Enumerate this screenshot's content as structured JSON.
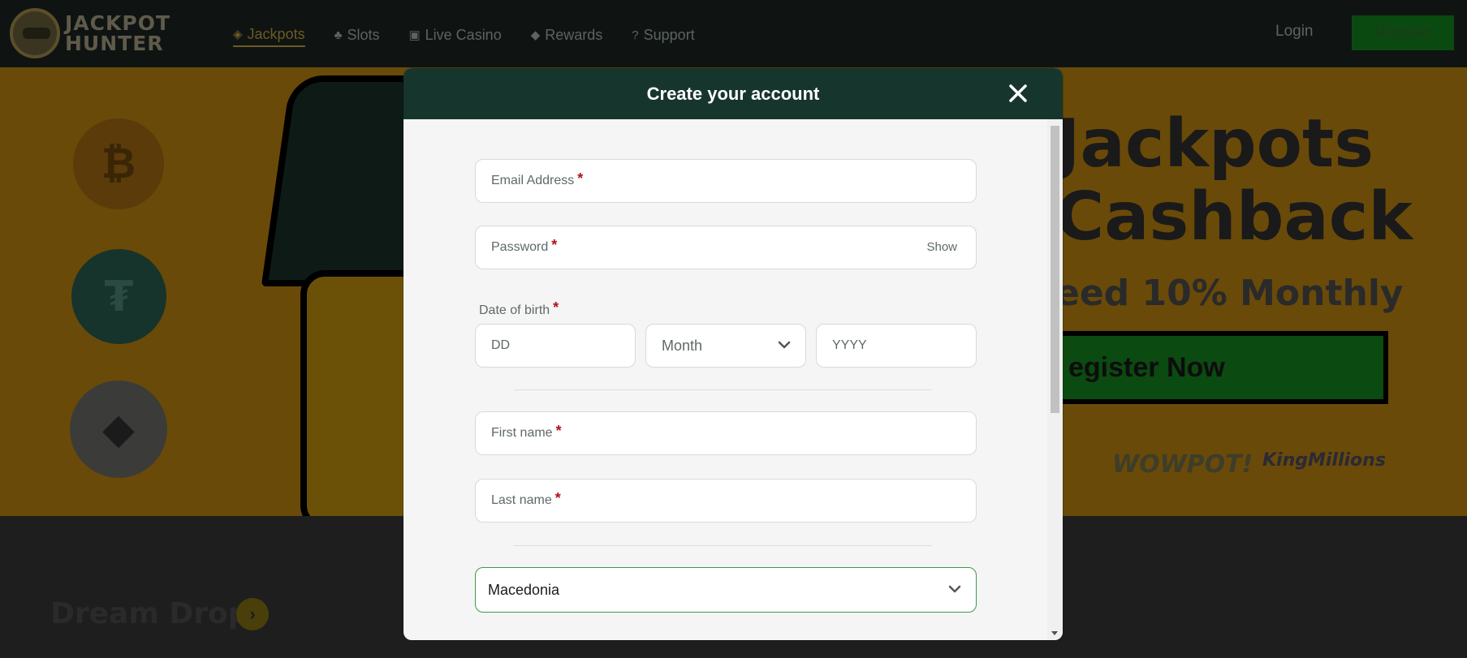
{
  "brand": {
    "line1": "JACKPOT",
    "line2": "HUNTER"
  },
  "nav": {
    "items": [
      {
        "label": "Jackpots",
        "icon": "diamond-icon",
        "glyph": "◈",
        "active": true
      },
      {
        "label": "Slots",
        "icon": "slots-icon",
        "glyph": "♣",
        "active": false
      },
      {
        "label": "Live Casino",
        "icon": "live-casino-icon",
        "glyph": "▣",
        "active": false
      },
      {
        "label": "Rewards",
        "icon": "tag-icon",
        "glyph": "◆",
        "active": false
      },
      {
        "label": "Support",
        "icon": "question-icon",
        "glyph": "?",
        "active": false
      }
    ],
    "login": "Login",
    "register": "Register"
  },
  "hero": {
    "coins": [
      {
        "name": "bitcoin-icon",
        "glyph": "₿"
      },
      {
        "name": "tether-icon",
        "glyph": "₮"
      },
      {
        "name": "ethereum-icon",
        "glyph": "◆"
      }
    ],
    "title_line1": "Jackpots",
    "title_line2": "Cashback",
    "subtitle": "eed 10% Monthly",
    "cta": "egister Now",
    "providers": [
      "WOWPOT!",
      "KingMillions"
    ]
  },
  "section": {
    "title": "Dream Drop",
    "arrow": "›"
  },
  "modal": {
    "title": "Create your account",
    "required_mark": "*",
    "email_label": "Email Address",
    "password_label": "Password",
    "password_toggle": "Show",
    "dob_label": "Date of birth",
    "dob_day_placeholder": "DD",
    "dob_month_placeholder": "Month",
    "dob_year_placeholder": "YYYY",
    "first_name_label": "First name",
    "last_name_label": "Last name",
    "country_value": "Macedonia"
  },
  "colors": {
    "modal_header": "#16362d",
    "required": "#b3121b",
    "country_border": "#3d9b46"
  }
}
